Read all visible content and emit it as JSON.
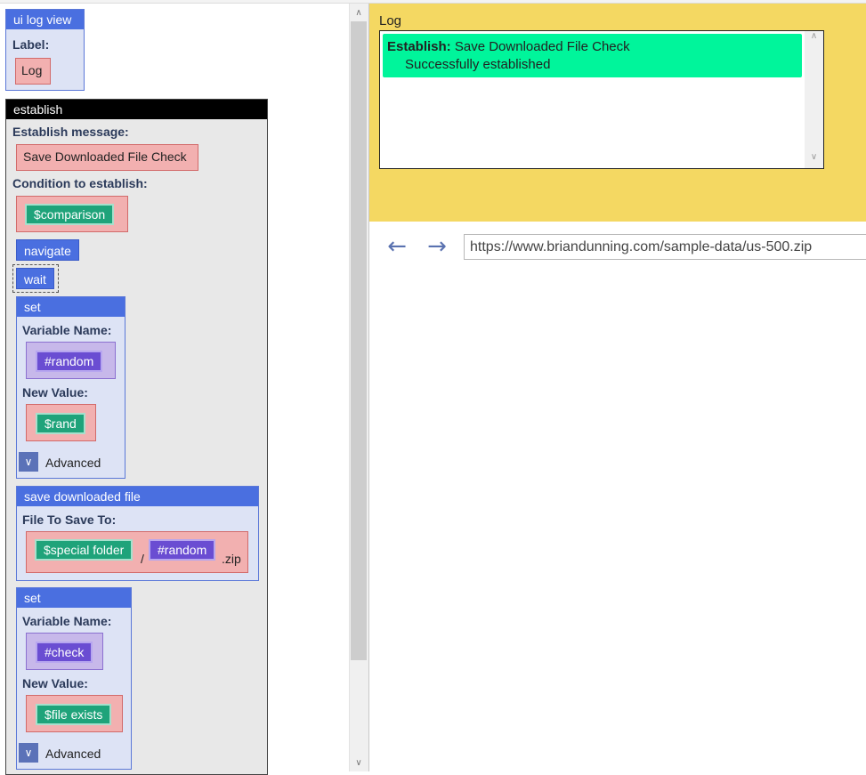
{
  "ui_log_view": {
    "title": "ui log view",
    "label_caption": "Label:",
    "label_value": "Log"
  },
  "establish": {
    "title": "establish",
    "message_caption": "Establish message:",
    "message_value": "Save Downloaded File Check",
    "condition_caption": "Condition to establish:",
    "condition_value": "$comparison",
    "steps": {
      "navigate": "navigate",
      "wait": "wait",
      "set1": {
        "title": "set",
        "varname_caption": "Variable Name:",
        "varname_value": "#random",
        "newvalue_caption": "New Value:",
        "newvalue_value": "$rand",
        "advanced": "Advanced"
      },
      "save": {
        "title": "save downloaded file",
        "file_caption": "File To Save To:",
        "part1": "$special folder",
        "separator": "/",
        "part2": "#random",
        "suffix": ".zip"
      },
      "set2": {
        "title": "set",
        "varname_caption": "Variable Name:",
        "varname_value": "#check",
        "newvalue_caption": "New Value:",
        "newvalue_value": "$file exists",
        "advanced": "Advanced"
      }
    }
  },
  "log": {
    "title": "Log",
    "entry_bold": "Establish:",
    "entry_text": "Save Downloaded File Check",
    "entry_detail": "Successfully established"
  },
  "browser": {
    "url": "https://www.briandunning.com/sample-data/us-500.zip"
  },
  "icons": {
    "back": "back-arrow-icon",
    "forward": "forward-arrow-icon",
    "chevron": "chevron-down-icon"
  },
  "colors": {
    "block_header": "#4a6fe0",
    "log_background": "#f4d862",
    "log_entry": "#00f59b",
    "variable_chip": "#1fa37a",
    "name_chip": "#6a4dd2"
  }
}
